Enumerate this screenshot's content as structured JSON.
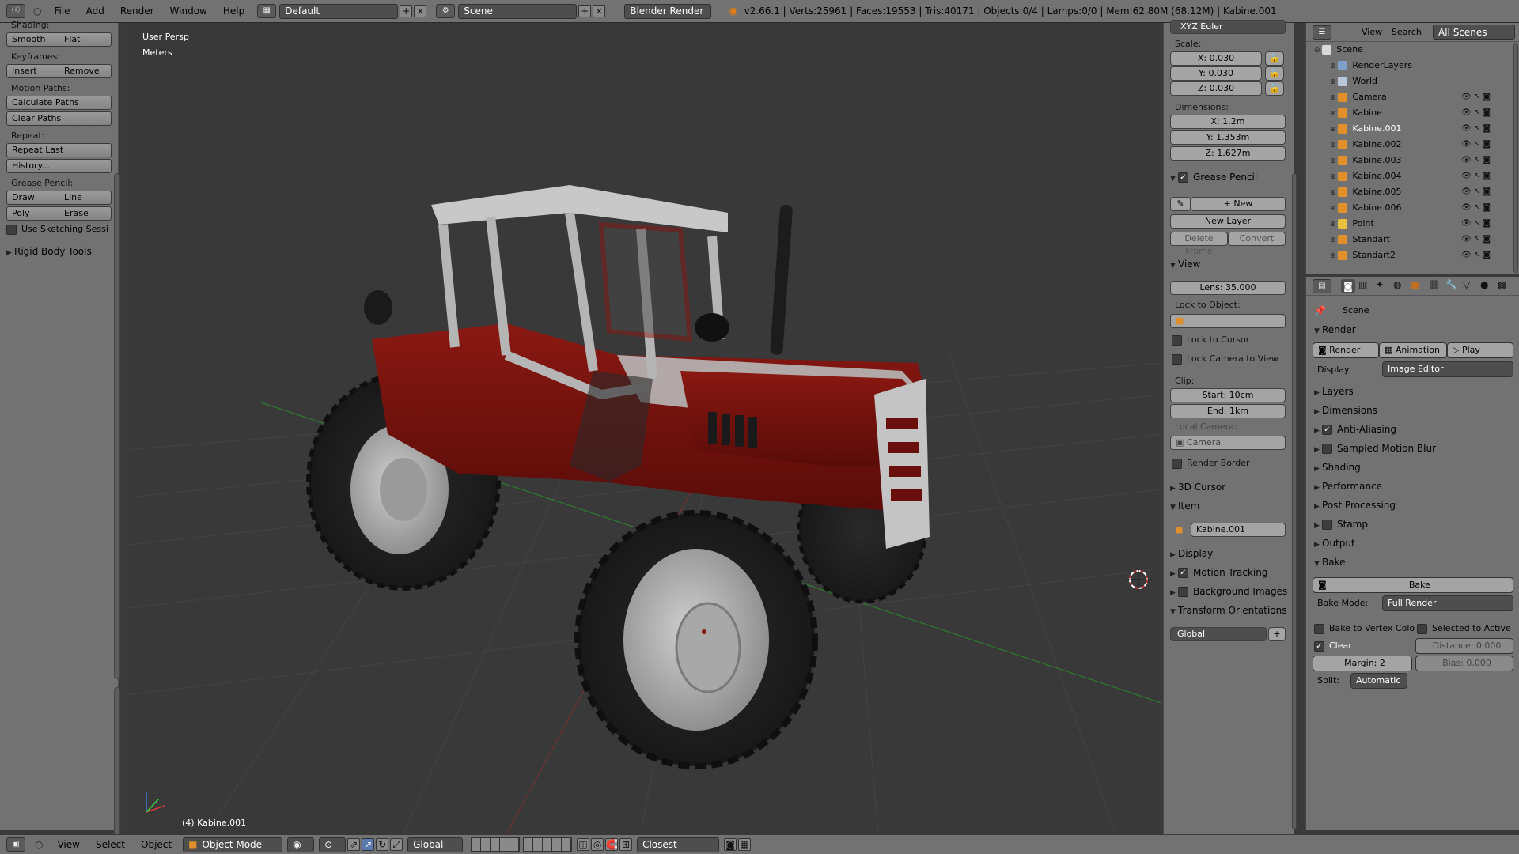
{
  "topbar": {
    "menus": [
      "File",
      "Add",
      "Render",
      "Window",
      "Help"
    ],
    "screen_layout": "Default",
    "scene": "Scene",
    "render_engine": "Blender Render",
    "stats": "v2.66.1 | Verts:25961 | Faces:19553 | Tris:40171 | Objects:0/4 | Lamps:0/0 | Mem:62.80M (68.12M) | Kabine.001"
  },
  "toolshelf": {
    "shading_label": "Shading:",
    "smooth": "Smooth",
    "flat": "Flat",
    "keyframes_label": "Keyframes:",
    "insert": "Insert",
    "remove": "Remove",
    "motion_paths_label": "Motion Paths:",
    "calculate_paths": "Calculate Paths",
    "clear_paths": "Clear Paths",
    "repeat_label": "Repeat:",
    "repeat_last": "Repeat Last",
    "history": "History...",
    "grease_pencil_label": "Grease Pencil:",
    "draw": "Draw",
    "line": "Line",
    "poly": "Poly",
    "erase": "Erase",
    "use_sketching": "Use Sketching Sessi",
    "rigid_body_tools": "Rigid Body Tools"
  },
  "viewport": {
    "view_name": "User Persp",
    "units": "Meters",
    "active_object": "(4) Kabine.001"
  },
  "npanel": {
    "rotation_mode": "XYZ Euler",
    "scale_label": "Scale:",
    "scale_x": "X: 0.030",
    "scale_y": "Y: 0.030",
    "scale_z": "Z: 0.030",
    "dimensions_label": "Dimensions:",
    "dim_x": "X: 1.2m",
    "dim_y": "Y: 1.353m",
    "dim_z": "Z: 1.627m",
    "grease_pencil": "Grease Pencil",
    "gp_new": "New",
    "gp_new_layer": "New Layer",
    "gp_delete_frame": "Delete Frame",
    "gp_convert": "Convert",
    "view": "View",
    "lens": "Lens: 35.000",
    "lock_to_object": "Lock to Object:",
    "lock_to_cursor": "Lock to Cursor",
    "lock_camera_to_view": "Lock Camera to View",
    "clip_label": "Clip:",
    "clip_start": "Start: 10cm",
    "clip_end": "End: 1km",
    "local_camera_label": "Local Camera:",
    "local_camera": "Camera",
    "render_border": "Render Border",
    "cursor_3d": "3D Cursor",
    "item": "Item",
    "item_name": "Kabine.001",
    "display": "Display",
    "motion_tracking": "Motion Tracking",
    "background_images": "Background Images",
    "transform_orientations": "Transform Orientations",
    "orientation": "Global"
  },
  "outliner": {
    "view_menu": "View",
    "search_menu": "Search",
    "display_mode": "All Scenes",
    "items": [
      {
        "name": "Scene",
        "indent": 0,
        "color": "#d8d8d8"
      },
      {
        "name": "RenderLayers",
        "indent": 1,
        "color": "#7fa0c8"
      },
      {
        "name": "World",
        "indent": 1,
        "color": "#b8c8d8"
      },
      {
        "name": "Camera",
        "indent": 1,
        "color": "#e0902a"
      },
      {
        "name": "Kabine",
        "indent": 1,
        "color": "#e0902a"
      },
      {
        "name": "Kabine.001",
        "indent": 1,
        "color": "#e0902a"
      },
      {
        "name": "Kabine.002",
        "indent": 1,
        "color": "#e0902a"
      },
      {
        "name": "Kabine.003",
        "indent": 1,
        "color": "#e0902a"
      },
      {
        "name": "Kabine.004",
        "indent": 1,
        "color": "#e0902a"
      },
      {
        "name": "Kabine.005",
        "indent": 1,
        "color": "#e0902a"
      },
      {
        "name": "Kabine.006",
        "indent": 1,
        "color": "#e0902a"
      },
      {
        "name": "Point",
        "indent": 1,
        "color": "#e8c040"
      },
      {
        "name": "Standart",
        "indent": 1,
        "color": "#e0902a"
      },
      {
        "name": "Standart2",
        "indent": 1,
        "color": "#e0902a"
      }
    ]
  },
  "props": {
    "scene_label": "Scene",
    "render_head": "Render",
    "render_btn": "Render",
    "animation_btn": "Animation",
    "play_btn": "Play",
    "display_label": "Display:",
    "display_value": "Image Editor",
    "layers": "Layers",
    "dimensions": "Dimensions",
    "anti_aliasing": "Anti-Aliasing",
    "sampled_motion_blur": "Sampled Motion Blur",
    "shading": "Shading",
    "performance": "Performance",
    "post_processing": "Post Processing",
    "stamp": "Stamp",
    "output": "Output",
    "bake_head": "Bake",
    "bake_btn": "Bake",
    "bake_mode_label": "Bake Mode:",
    "bake_mode": "Full Render",
    "bake_to_vertex": "Bake to Vertex Colo",
    "selected_to_active": "Selected to Active",
    "clear": "Clear",
    "distance": "Distance: 0.000",
    "margin": "Margin: 2",
    "bias": "Bias: 0.000",
    "split_label": "Split:",
    "split_value": "Automatic"
  },
  "bottombar": {
    "view": "View",
    "select": "Select",
    "object": "Object",
    "mode": "Object Mode",
    "orientation": "Global",
    "snap_target": "Closest"
  },
  "colors": {
    "panel_bg": "#727272",
    "viewport_bg": "#393939",
    "tractor_red": "#7a1410",
    "tractor_white": "#bdbdbd"
  }
}
